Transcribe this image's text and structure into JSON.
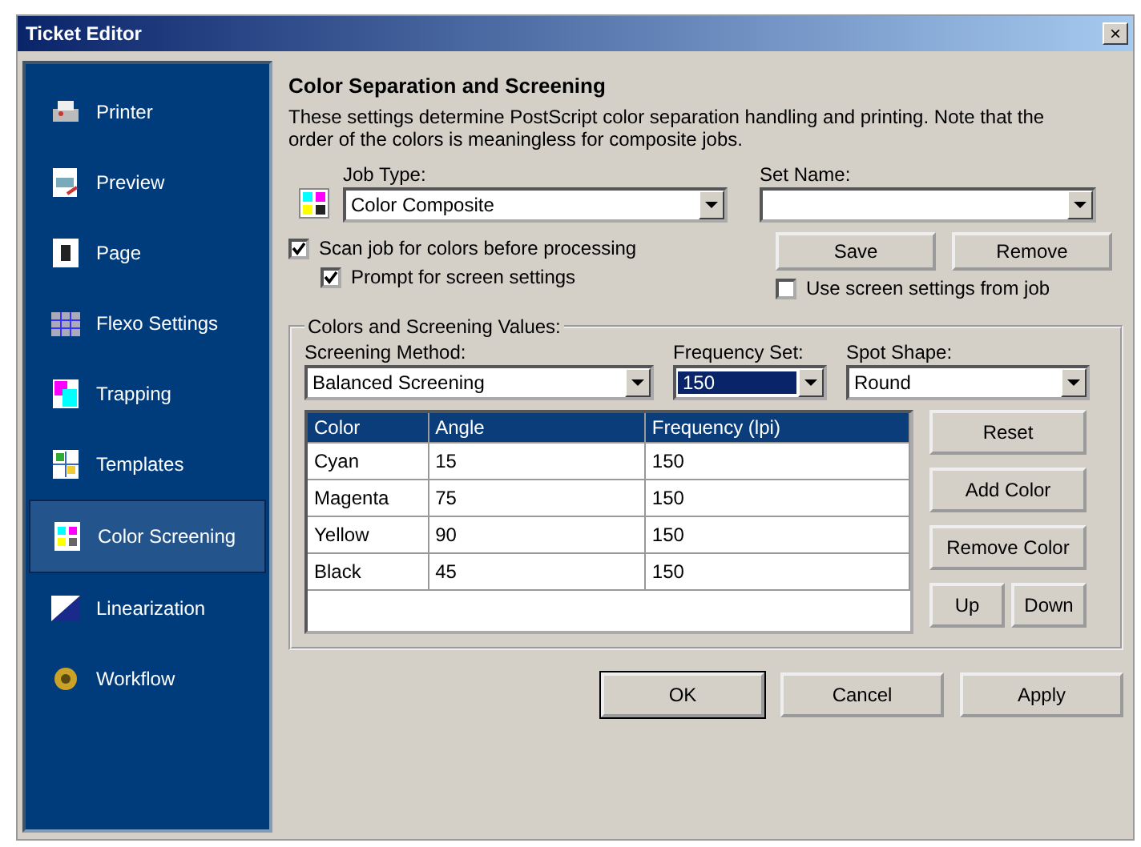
{
  "window": {
    "title": "Ticket Editor",
    "close": "×"
  },
  "sidebar": {
    "items": [
      {
        "label": "Printer",
        "selected": false
      },
      {
        "label": "Preview",
        "selected": false
      },
      {
        "label": "Page",
        "selected": false
      },
      {
        "label": "Flexo Settings",
        "selected": false
      },
      {
        "label": "Trapping",
        "selected": false
      },
      {
        "label": "Templates",
        "selected": false
      },
      {
        "label": "Color Screening",
        "selected": true
      },
      {
        "label": "Linearization",
        "selected": false
      },
      {
        "label": "Workflow",
        "selected": false
      }
    ]
  },
  "heading": "Color Separation and Screening",
  "description": "These settings determine PostScript color separation handling and printing. Note that the order of the colors is meaningless for composite jobs.",
  "job_type": {
    "label": "Job Type:",
    "value": "Color Composite"
  },
  "set_name": {
    "label": "Set Name:"
  },
  "checkboxes": [
    {
      "label": "Scan job for colors before processing",
      "checked": true
    },
    {
      "label": "Prompt for screen settings",
      "checked": true
    }
  ],
  "set_buttons": [
    "Save",
    "Remove"
  ],
  "use_screen_settings": {
    "label": "Use screen settings from job",
    "checked": false
  },
  "group": {
    "title": "Colors and Screening Values:",
    "dropdowns": [
      {
        "label": "Screening Method:",
        "value": "Balanced Screening",
        "highlighted": false
      },
      {
        "label": "Frequency Set:",
        "value": "150",
        "highlighted": true
      },
      {
        "label": "Spot Shape:",
        "value": "Round",
        "highlighted": false
      }
    ],
    "table": {
      "columns": [
        "Color",
        "Angle",
        "Frequency (lpi)"
      ],
      "rows": [
        [
          "Cyan",
          "15",
          "150"
        ],
        [
          "Magenta",
          "75",
          "150"
        ],
        [
          "Yellow",
          "90",
          "150"
        ],
        [
          "Black",
          "45",
          "150"
        ]
      ]
    },
    "buttons": [
      "Reset",
      "Add Color",
      "Remove Color"
    ],
    "order_buttons": [
      "Up",
      "Down"
    ]
  },
  "footer_buttons": [
    "OK",
    "Cancel",
    "Apply"
  ]
}
